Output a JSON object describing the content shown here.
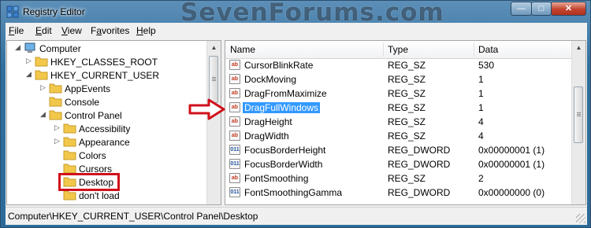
{
  "window": {
    "title": "Registry Editor",
    "watermark": "SevenForums.com",
    "controls": {
      "minimize": "—",
      "maximize": "□",
      "close": "✕"
    }
  },
  "menu": {
    "items": [
      {
        "label": "File",
        "u": "F",
        "rest": "ile"
      },
      {
        "label": "Edit",
        "u": "E",
        "rest": "dit"
      },
      {
        "label": "View",
        "u": "V",
        "rest": "iew"
      },
      {
        "label": "Favorites",
        "u": "F",
        "rest": "a",
        "rest2": "vorites"
      },
      {
        "label": "Help",
        "u": "H",
        "rest": "elp"
      }
    ]
  },
  "tree": {
    "items": [
      {
        "label": "Computer",
        "arrow": "◢",
        "icon": "computer-icon"
      },
      {
        "label": "HKEY_CLASSES_ROOT",
        "arrow": "▷",
        "icon": "folder-icon"
      },
      {
        "label": "HKEY_CURRENT_USER",
        "arrow": "◢",
        "icon": "folder-icon"
      },
      {
        "label": "AppEvents",
        "arrow": "▷",
        "icon": "folder-icon"
      },
      {
        "label": "Console",
        "arrow": "",
        "icon": "folder-icon"
      },
      {
        "label": "Control Panel",
        "arrow": "◢",
        "icon": "folder-icon"
      },
      {
        "label": "Accessibility",
        "arrow": "▷",
        "icon": "folder-icon"
      },
      {
        "label": "Appearance",
        "arrow": "▷",
        "icon": "folder-icon"
      },
      {
        "label": "Colors",
        "arrow": "",
        "icon": "folder-icon"
      },
      {
        "label": "Cursors",
        "arrow": "",
        "icon": "folder-icon"
      },
      {
        "label": "Desktop",
        "arrow": "",
        "icon": "folder-icon",
        "highlighted": true
      },
      {
        "label": "don't load",
        "arrow": "",
        "icon": "folder-icon"
      }
    ]
  },
  "list": {
    "columns": [
      "Name",
      "Type",
      "Data"
    ],
    "rows": [
      {
        "name": "CursorBlinkRate",
        "type": "REG_SZ",
        "data": "530",
        "icon": "sz"
      },
      {
        "name": "DockMoving",
        "type": "REG_SZ",
        "data": "1",
        "icon": "sz"
      },
      {
        "name": "DragFromMaximize",
        "type": "REG_SZ",
        "data": "1",
        "icon": "sz"
      },
      {
        "name": "DragFullWindows",
        "type": "REG_SZ",
        "data": "1",
        "icon": "sz",
        "selected": true
      },
      {
        "name": "DragHeight",
        "type": "REG_SZ",
        "data": "4",
        "icon": "sz"
      },
      {
        "name": "DragWidth",
        "type": "REG_SZ",
        "data": "4",
        "icon": "sz"
      },
      {
        "name": "FocusBorderHeight",
        "type": "REG_DWORD",
        "data": "0x00000001 (1)",
        "icon": "dw"
      },
      {
        "name": "FocusBorderWidth",
        "type": "REG_DWORD",
        "data": "0x00000001 (1)",
        "icon": "dw"
      },
      {
        "name": "FontSmoothing",
        "type": "REG_SZ",
        "data": "2",
        "icon": "sz"
      },
      {
        "name": "FontSmoothingGamma",
        "type": "REG_DWORD",
        "data": "0x00000000 (0)",
        "icon": "dw"
      }
    ],
    "icon_labels": {
      "sz": "ab",
      "dw": "011"
    }
  },
  "status": {
    "path": "Computer\\HKEY_CURRENT_USER\\Control Panel\\Desktop"
  },
  "colors": {
    "selection": "#3399ff",
    "annotation_red": "#d0101a"
  }
}
